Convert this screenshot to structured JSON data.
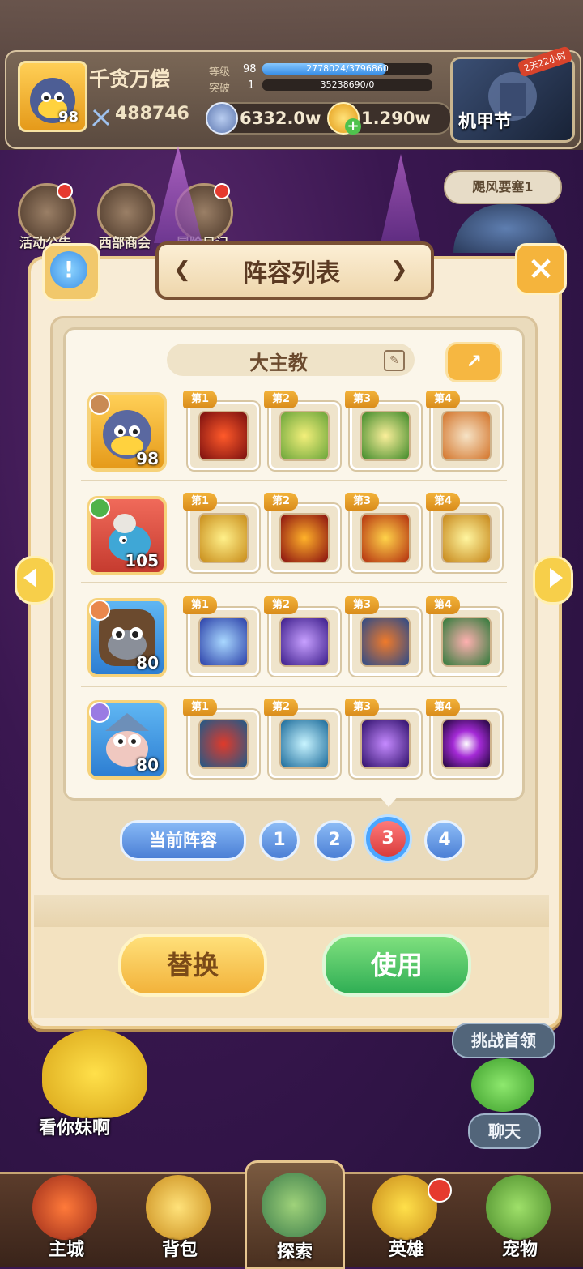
{
  "player": {
    "name": "千贪万偿",
    "level": "98",
    "power": "488746",
    "level_label": "等级",
    "level_value": "98",
    "level_progress_text": "2778024/3796860",
    "level_progress": 0.73,
    "break_label": "突破",
    "break_value": "1",
    "break_progress_text": "35238690/0",
    "break_progress": 0.0
  },
  "currencies": {
    "silver": "6332.0w",
    "gold": "1.290w"
  },
  "event": {
    "label": "机甲节",
    "tag": "2天22小时"
  },
  "side_buttons": [
    {
      "label": "活动公告"
    },
    {
      "label": "西部商会"
    },
    {
      "label": "冒险日记"
    }
  ],
  "right_widgets": {
    "fortress": "飓风要塞1",
    "challenge": "挑战首领",
    "chat": "聊天"
  },
  "modal": {
    "title": "阵容列表",
    "info_symbol": "!",
    "close_symbol": "×",
    "lineup_name": "大主教",
    "edit_symbol": "✎",
    "share_symbol": "↗",
    "rows": [
      {
        "hero_level": "98",
        "skills": [
          "第1",
          "第2",
          "第3",
          "第4"
        ]
      },
      {
        "hero_level": "105",
        "skills": [
          "第1",
          "第2",
          "第3",
          "第4"
        ]
      },
      {
        "hero_level": "80",
        "skills": [
          "第1",
          "第2",
          "第3",
          "第4"
        ]
      },
      {
        "hero_level": "80",
        "skills": [
          "第1",
          "第2",
          "第3",
          "第4"
        ]
      }
    ],
    "current_tab_label": "当前阵容",
    "tabs": [
      "1",
      "2",
      "3",
      "4"
    ],
    "active_tab": "3",
    "replace_label": "替换",
    "use_label": "使用"
  },
  "mascot_caption": "看你妹啊",
  "bottom_nav": [
    {
      "label": "主城"
    },
    {
      "label": "背包"
    },
    {
      "label": "探索"
    },
    {
      "label": "英雄"
    },
    {
      "label": "宠物"
    }
  ],
  "colors": {
    "accent_blue": "#4b7fd5",
    "accent_gold": "#f2b23a",
    "accent_green": "#2fae54",
    "tab_active_red": "#d93c3c"
  }
}
